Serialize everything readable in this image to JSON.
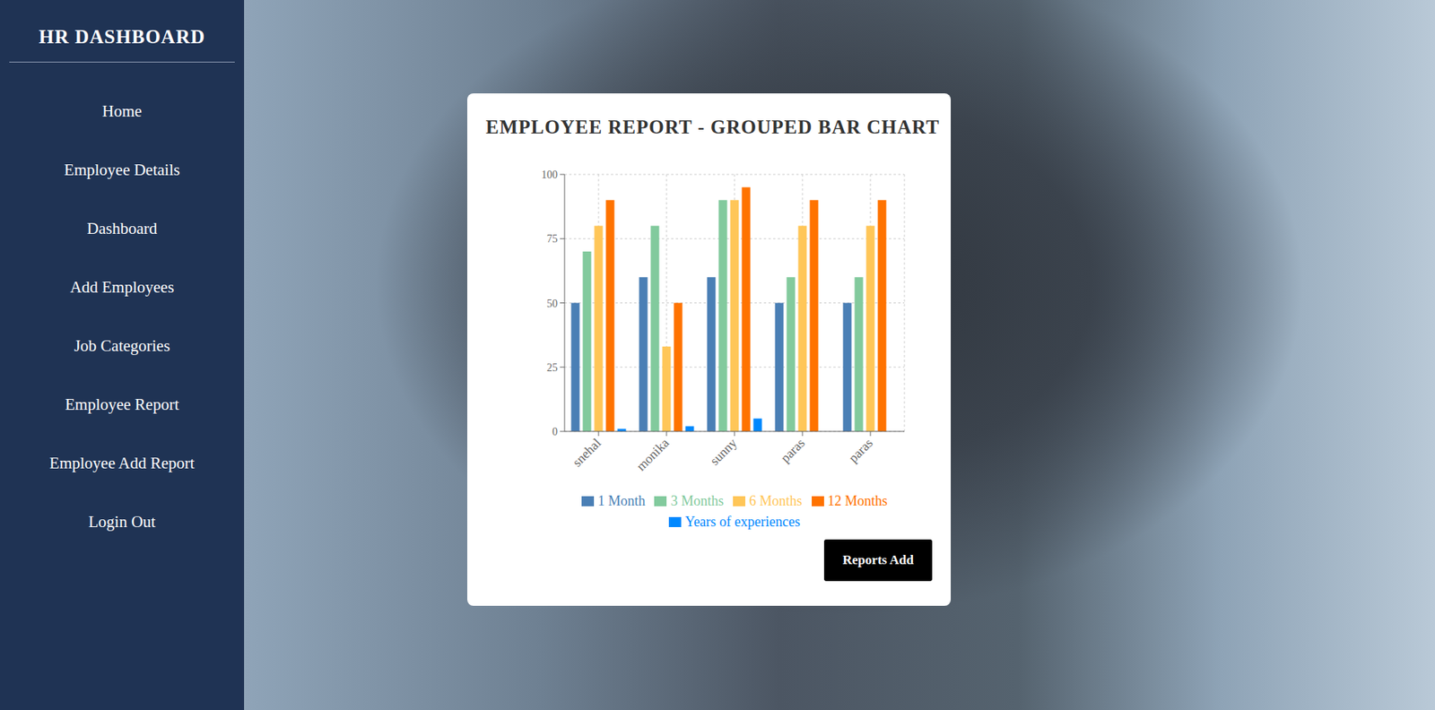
{
  "sidebar": {
    "title": "HR DASHBOARD",
    "items": [
      {
        "label": "Home",
        "selected": false
      },
      {
        "label": "Employee Details",
        "selected": false
      },
      {
        "label": "Dashboard",
        "selected": false
      },
      {
        "label": "Add Employees",
        "selected": false
      },
      {
        "label": "Job Categories",
        "selected": false
      },
      {
        "label": "Employee Report",
        "selected": false
      },
      {
        "label": "Employee Add Report",
        "selected": false
      },
      {
        "label": "Login Out",
        "selected": false
      }
    ]
  },
  "card": {
    "title": "EMPLOYEE REPORT - GROUPED BAR CHART",
    "button": "Reports Add"
  },
  "chart": {
    "y_ticks": [
      "0",
      "25",
      "50",
      "75",
      "100"
    ],
    "categories": [
      "snehal",
      "monika",
      "sunny",
      "paras",
      "paras"
    ],
    "series": [
      {
        "name": "1 Month",
        "color": "#4a7fb5",
        "values": [
          50,
          60,
          60,
          50,
          50
        ]
      },
      {
        "name": "3 Months",
        "color": "#82ca9d",
        "values": [
          70,
          80,
          90,
          60,
          60
        ]
      },
      {
        "name": "6 Months",
        "color": "#ffc658",
        "values": [
          80,
          33,
          90,
          80,
          80
        ]
      },
      {
        "name": "12 Months",
        "color": "#ff7300",
        "values": [
          90,
          50,
          95,
          90,
          90
        ]
      },
      {
        "name": "Years of experiences",
        "color": "#0088fe",
        "values": [
          1,
          2,
          5,
          0,
          0
        ]
      }
    ]
  }
}
